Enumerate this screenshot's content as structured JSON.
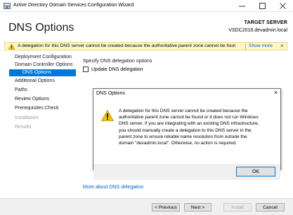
{
  "window": {
    "title": "Active Directory Domain Services Configuration Wizard",
    "app_icon": "ad-wizard-icon"
  },
  "header": {
    "page_title": "DNS Options",
    "target_label": "TARGET SERVER",
    "target_server": "VSDC2016.devadmin.local"
  },
  "warning_bar": {
    "icon": "warning-icon",
    "text": "A delegation for this DNS server cannot be created because the authoritative parent zone cannot be found...",
    "show_more": "Show more",
    "close": "×"
  },
  "nav": {
    "items": [
      {
        "label": "Deployment Configuration"
      },
      {
        "label": "Domain Controller Options"
      },
      {
        "label": "DNS Options"
      },
      {
        "label": "Additional Options"
      },
      {
        "label": "Paths"
      },
      {
        "label": "Review Options"
      },
      {
        "label": "Prerequisites Check"
      },
      {
        "label": "Installation"
      },
      {
        "label": "Results"
      }
    ]
  },
  "main": {
    "section_label": "Specify DNS delegation options",
    "checkbox_label": "Update DNS delegation",
    "more_link": "More about DNS delegation"
  },
  "dialog": {
    "title": "DNS Options",
    "close": "×",
    "message": "A delegation for this DNS server cannot be created because the\nauthoritative parent zone cannot be found or it does not run Windows\nDNS server. If you are integrating with an existing DNS infrastructure,\nyou should manually create a delegation to this DNS server in the\nparent zone to ensure reliable name resolution from outside the\ndomain \"devadmin.local\". Otherwise, no action is required.",
    "ok_label": "OK"
  },
  "footer": {
    "previous": "< Previous",
    "next": "Next >",
    "install": "Install",
    "cancel": "Cancel"
  },
  "colors": {
    "accent": "#0078d7",
    "warning_bg": "#fdf7c3",
    "link": "#0066cc"
  }
}
